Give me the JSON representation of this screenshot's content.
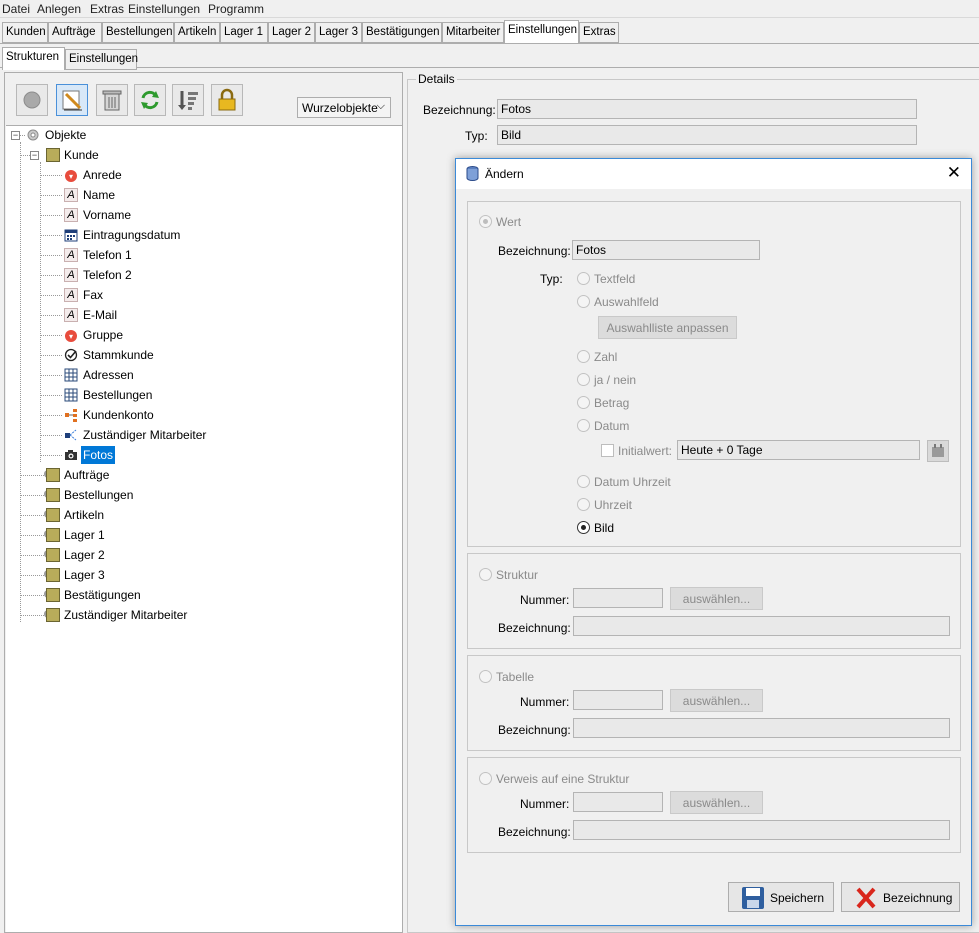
{
  "menu": [
    "Datei",
    "Anlegen",
    "Extras",
    "Einstellungen",
    "Programm"
  ],
  "tabs": [
    "Kunden",
    "Aufträge",
    "Bestellungen",
    "Artikeln",
    "Lager 1",
    "Lager 2",
    "Lager 3",
    "Bestätigungen",
    "Mitarbeiter",
    "Einstellungen",
    "Extras"
  ],
  "active_tab": "Einstellungen",
  "subtabs": [
    "Strukturen",
    "Einstellungen"
  ],
  "toolbar": {
    "icons": [
      "record-icon",
      "edit-pencil-icon",
      "trash-icon",
      "refresh-icon",
      "sort-icon",
      "lock-icon"
    ],
    "root_combo": "Wurzelobjekte"
  },
  "tree": {
    "root": "Objekte",
    "kunde": "Kunde",
    "kunde_children": [
      "Anrede",
      "Name",
      "Vorname",
      "Eintragungsdatum",
      "Telefon 1",
      "Telefon 2",
      "Fax",
      "E-Mail",
      "Gruppe",
      "Stammkunde",
      "Adressen",
      "Bestellungen",
      "Kundenkonto",
      "Zuständiger Mitarbeiter",
      "Fotos"
    ],
    "selected": "Fotos",
    "others": [
      "Aufträge",
      "Bestellungen",
      "Artikeln",
      "Lager 1",
      "Lager 2",
      "Lager 3",
      "Bestätigungen",
      "Zuständiger Mitarbeiter"
    ]
  },
  "details": {
    "title": "Details",
    "bezeichnung_label": "Bezeichnung:",
    "bezeichnung_value": "Fotos",
    "typ_label": "Typ:",
    "typ_value": "Bild"
  },
  "dialog": {
    "title": "Ändern",
    "wert": {
      "label": "Wert",
      "bezeichnung_label": "Bezeichnung:",
      "bezeichnung_value": "Fotos",
      "typ_label": "Typ:",
      "types_a": [
        "Textfeld",
        "Auswahlfeld"
      ],
      "auswahlliste_button": "Auswahlliste anpassen",
      "types_b": [
        "Zahl",
        "ja / nein",
        "Betrag",
        "Datum"
      ],
      "initialwert_label": "Initialwert:",
      "initialwert_value": "Heute + 0 Tage",
      "types_c": [
        "Datum Uhrzeit",
        "Uhrzeit",
        "Bild"
      ],
      "selected_type": "Bild"
    },
    "struktur": {
      "label": "Struktur",
      "nummer_label": "Nummer:",
      "select_button": "auswählen...",
      "bezeichnung_label": "Bezeichnung:"
    },
    "tabelle": {
      "label": "Tabelle",
      "nummer_label": "Nummer:",
      "select_button": "auswählen...",
      "bezeichnung_label": "Bezeichnung:"
    },
    "verweis": {
      "label": "Verweis auf eine Struktur",
      "nummer_label": "Nummer:",
      "select_button": "auswählen...",
      "bezeichnung_label": "Bezeichnung:"
    },
    "save_button": "Speichern",
    "cancel_button": "Bezeichnung"
  },
  "colors": {
    "selection": "#0078d7",
    "dialog_border": "#3b8ad8",
    "folder": "#b8ac5a"
  }
}
